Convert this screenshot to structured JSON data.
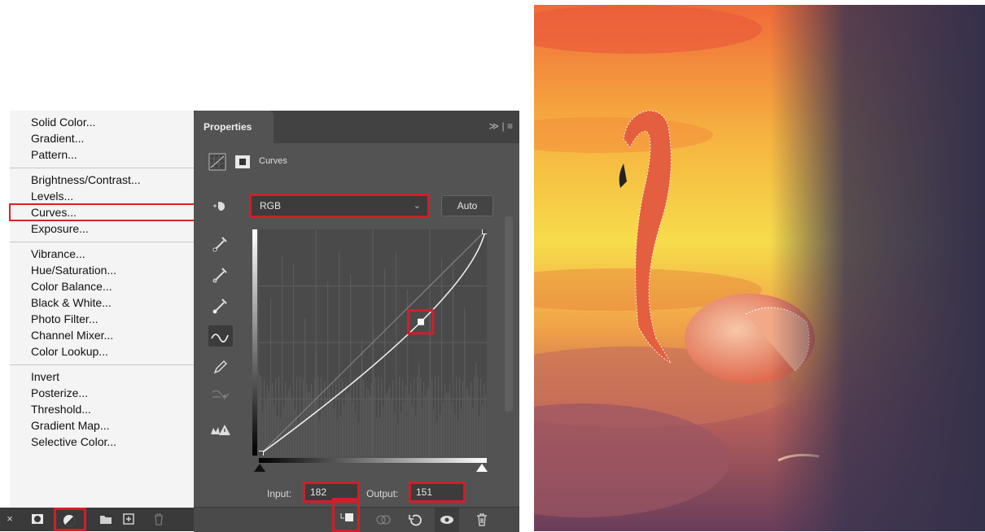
{
  "menu": {
    "groups": [
      [
        "Solid Color...",
        "Gradient...",
        "Pattern..."
      ],
      [
        "Brightness/Contrast...",
        "Levels...",
        "Curves...",
        "Exposure..."
      ],
      [
        "Vibrance...",
        "Hue/Saturation...",
        "Color Balance...",
        "Black & White...",
        "Photo Filter...",
        "Channel Mixer...",
        "Color Lookup..."
      ],
      [
        "Invert",
        "Posterize...",
        "Threshold...",
        "Gradient Map...",
        "Selective Color..."
      ]
    ],
    "highlighted": "Curves..."
  },
  "layer_toolbar": {
    "icons": [
      "close-icon",
      "mask-icon",
      "adjustment-layer-icon",
      "folder-icon",
      "new-layer-icon",
      "trash-icon"
    ]
  },
  "properties": {
    "tab_label": "Properties",
    "panel_menu": "≫ | ≡",
    "adjustment_label": "Curves",
    "channel": "RGB",
    "auto_label": "Auto",
    "input_label": "Input:",
    "input_value": "182",
    "output_label": "Output:",
    "output_value": "151",
    "tools": [
      "target-adjust-icon",
      "black-point-eyedropper-icon",
      "gray-point-eyedropper-icon",
      "white-point-eyedropper-icon",
      "curve-point-icon",
      "pencil-icon",
      "smooth-icon",
      "clipping-warning-icon"
    ],
    "footer_icons": [
      "clip-to-layer-icon",
      "view-previous-icon",
      "reset-icon",
      "visibility-icon",
      "delete-icon"
    ]
  },
  "curve": {
    "points": [
      [
        0,
        0
      ],
      [
        182,
        151
      ],
      [
        255,
        255
      ]
    ],
    "selected_point": [
      182,
      151
    ]
  },
  "colors": {
    "accent_red": "#d11e2a",
    "panel_bg": "#535353",
    "menu_bg": "#f4f4f4"
  }
}
